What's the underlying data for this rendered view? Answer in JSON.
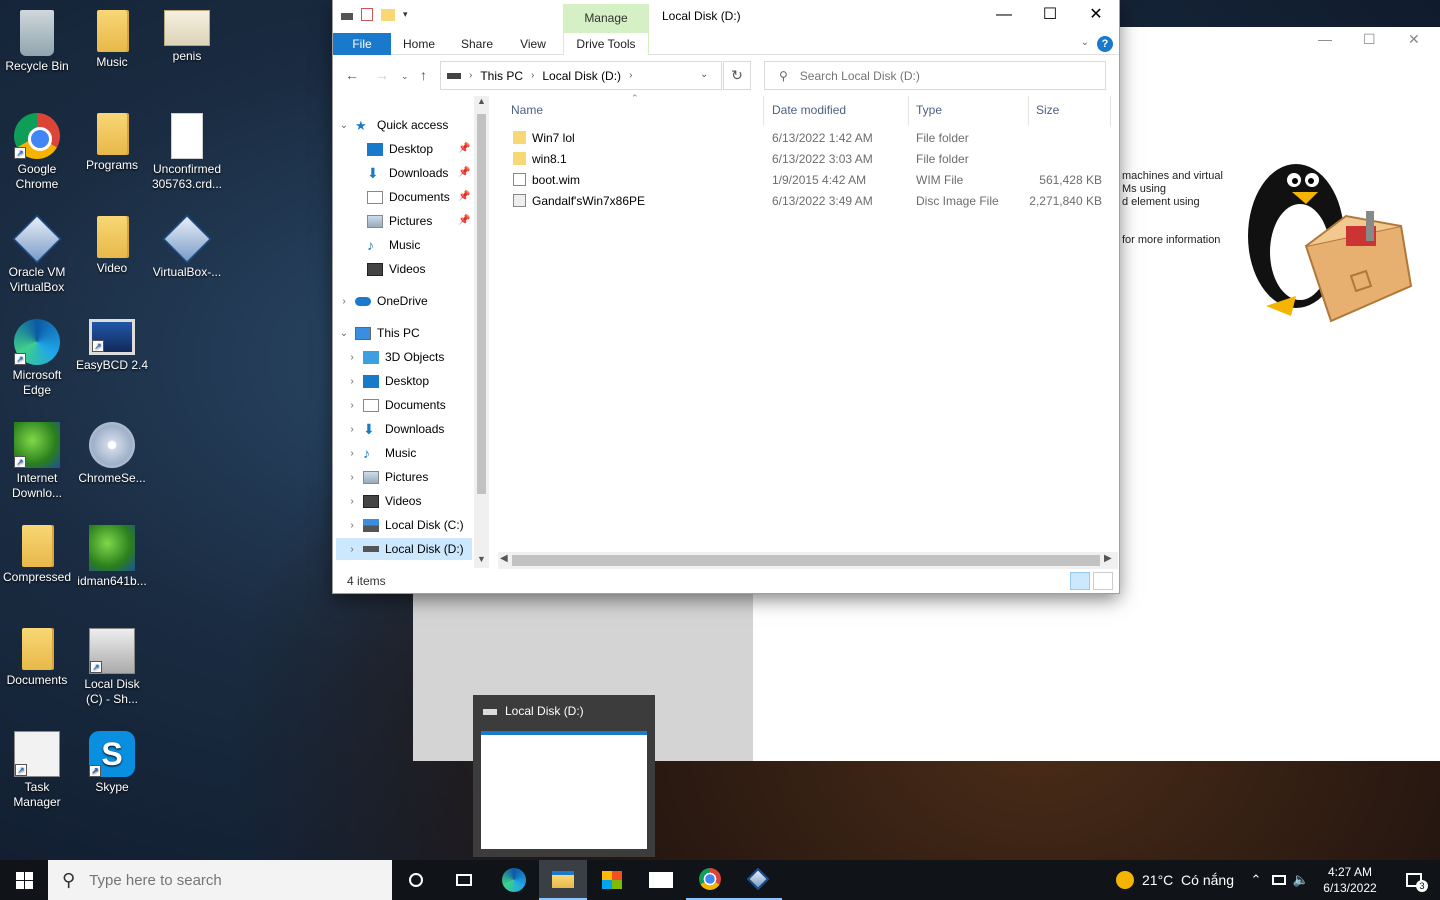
{
  "desktop": {
    "icons": [
      {
        "label": "Recycle Bin"
      },
      {
        "label": "Music"
      },
      {
        "label": "penis"
      },
      {
        "label": "Google Chrome"
      },
      {
        "label": "Programs"
      },
      {
        "label": "Unconfirmed 305763.crd..."
      },
      {
        "label": "Oracle VM VirtualBox"
      },
      {
        "label": "Video"
      },
      {
        "label": "VirtualBox-..."
      },
      {
        "label": "Microsoft Edge"
      },
      {
        "label": "EasyBCD 2.4"
      },
      {
        "label": "Internet Downlo..."
      },
      {
        "label": "ChromeSe..."
      },
      {
        "label": "Compressed"
      },
      {
        "label": "idman641b..."
      },
      {
        "label": "Documents"
      },
      {
        "label": "Local Disk (C) - Sh..."
      },
      {
        "label": "Task Manager"
      },
      {
        "label": "Skype"
      }
    ]
  },
  "background_window": {
    "text_lines": [
      "machines and virtual",
      "Ms using",
      "d element using",
      "for more information"
    ]
  },
  "explorer": {
    "title": "Local Disk (D:)",
    "contextual_tab": "Manage",
    "tabs": {
      "file": "File",
      "home": "Home",
      "share": "Share",
      "view": "View",
      "drive_tools": "Drive Tools"
    },
    "address": {
      "this_pc": "This PC",
      "drive": "Local Disk (D:)"
    },
    "search_placeholder": "Search Local Disk (D:)",
    "nav": {
      "quick_access": "Quick access",
      "quick_items": [
        {
          "label": "Desktop"
        },
        {
          "label": "Downloads"
        },
        {
          "label": "Documents"
        },
        {
          "label": "Pictures"
        },
        {
          "label": "Music"
        },
        {
          "label": "Videos"
        }
      ],
      "onedrive": "OneDrive",
      "this_pc": "This PC",
      "pc_items": [
        {
          "label": "3D Objects"
        },
        {
          "label": "Desktop"
        },
        {
          "label": "Documents"
        },
        {
          "label": "Downloads"
        },
        {
          "label": "Music"
        },
        {
          "label": "Pictures"
        },
        {
          "label": "Videos"
        },
        {
          "label": "Local Disk (C:)"
        },
        {
          "label": "Local Disk (D:)"
        }
      ]
    },
    "columns": {
      "name": "Name",
      "date": "Date modified",
      "type": "Type",
      "size": "Size"
    },
    "files": [
      {
        "name": "Win7 lol",
        "date": "6/13/2022 1:42 AM",
        "type": "File folder",
        "size": ""
      },
      {
        "name": "win8.1",
        "date": "6/13/2022 3:03 AM",
        "type": "File folder",
        "size": ""
      },
      {
        "name": "boot.wim",
        "date": "1/9/2015 4:42 AM",
        "type": "WIM File",
        "size": "561,428 KB"
      },
      {
        "name": "Gandalf'sWin7x86PE",
        "date": "6/13/2022 3:49 AM",
        "type": "Disc Image File",
        "size": "2,271,840 KB"
      }
    ],
    "status": "4 items"
  },
  "thumbnail": {
    "title": "Local Disk (D:)"
  },
  "taskbar": {
    "search_placeholder": "Type here to search",
    "weather": "21°C  Có nắng",
    "time": "4:27 AM",
    "date": "6/13/2022",
    "notifications": "3"
  },
  "colors": {
    "accent": "#1979ca",
    "manage_tab": "#d4f0c4",
    "selection": "#cce8ff",
    "taskbar": "#101418"
  }
}
